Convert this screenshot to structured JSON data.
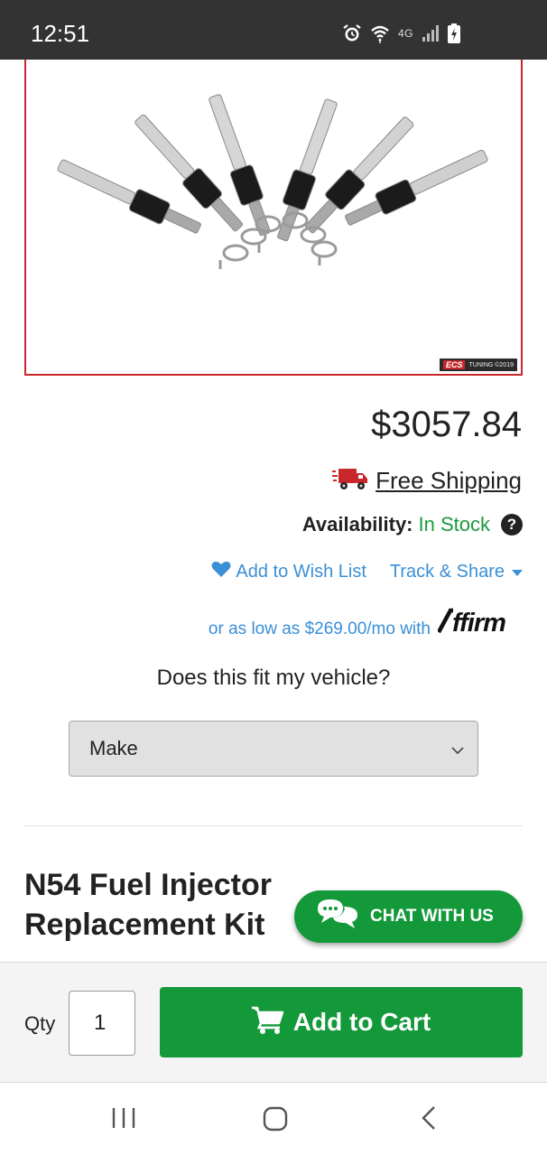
{
  "status_bar": {
    "time": "12:51",
    "icons": [
      "alarm-icon",
      "wifi-icon",
      "signal-icon",
      "battery-icon"
    ],
    "network_label": "4G"
  },
  "product": {
    "image_alt_icon": "fuel-injectors-image",
    "watermark": {
      "brand": "ECS",
      "text": "TUNING ©2019"
    },
    "price": "$3057.84",
    "shipping_label": "Free Shipping",
    "availability_label": "Availability:",
    "availability_value": "In Stock",
    "help_glyph": "?",
    "wish_list_label": "Add to Wish List",
    "track_share_label": "Track & Share",
    "financing_text": "or as low as $269.00/mo with",
    "affirm_logo_text": "Affirm",
    "fit_question": "Does this fit my vehicle?",
    "make_select_value": "Make",
    "title": "N54 Fuel Injector Replacement Kit"
  },
  "chat": {
    "label": "CHAT WITH US"
  },
  "cart_bar": {
    "qty_label": "Qty",
    "qty_value": "1",
    "add_to_cart_label": "Add to Cart"
  },
  "nav_bar": {
    "items": [
      "recent-apps-icon",
      "home-icon",
      "back-icon"
    ]
  },
  "colors": {
    "status_bar_bg": "#333333",
    "frame_border": "#c8282c",
    "green": "#14993a",
    "in_stock_green": "#1a9a3d",
    "link_blue": "#3a8fd6"
  }
}
